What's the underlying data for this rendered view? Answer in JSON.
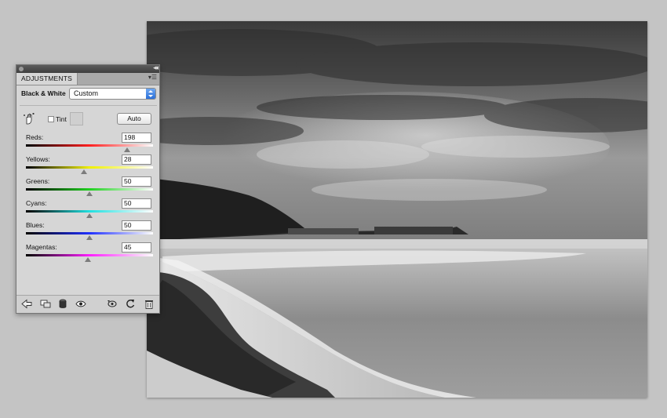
{
  "panel": {
    "tab_label": "ADJUSTMENTS",
    "adjustment_label": "Black & White",
    "preset_value": "Custom",
    "tint_label": "Tint",
    "tint_checked": false,
    "auto_label": "Auto",
    "sliders": [
      {
        "label": "Reds:",
        "value": "198",
        "level": 198,
        "gradient": [
          "#000000",
          "#ff2020",
          "#ffffff"
        ]
      },
      {
        "label": "Yellows:",
        "value": "28",
        "level": 28,
        "gradient": [
          "#000000",
          "#f0f000",
          "#ffffff"
        ]
      },
      {
        "label": "Greens:",
        "value": "50",
        "level": 50,
        "gradient": [
          "#000000",
          "#20d020",
          "#ffffff"
        ]
      },
      {
        "label": "Cyans:",
        "value": "50",
        "level": 50,
        "gradient": [
          "#000000",
          "#20e0e0",
          "#ffffff"
        ]
      },
      {
        "label": "Blues:",
        "value": "50",
        "level": 50,
        "gradient": [
          "#000000",
          "#2030ff",
          "#ffffff"
        ]
      },
      {
        "label": "Magentas:",
        "value": "45",
        "level": 45,
        "gradient": [
          "#000000",
          "#ff20ff",
          "#ffffff"
        ]
      }
    ],
    "slider_range": [
      -200,
      300
    ],
    "bottom_icons": [
      "back-arrow-icon",
      "clip-to-layer-icon",
      "layer-visibility-mask-icon",
      "eye-icon",
      "previous-state-icon",
      "reset-icon",
      "trash-icon"
    ]
  }
}
